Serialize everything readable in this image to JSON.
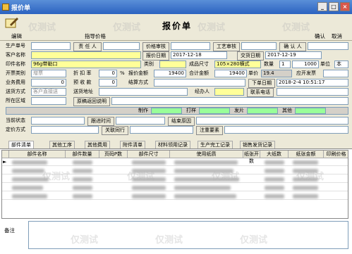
{
  "window": {
    "title": "报价单",
    "btn_min": "_",
    "btn_max": "□",
    "btn_close": "×"
  },
  "toolbar": {
    "doc_title": "报价单",
    "menu_edit": "编辑",
    "menu_price": "指导价格",
    "btn_confirm": "确认",
    "btn_cancel": "取消"
  },
  "form": {
    "prod_no_label": "生产单号",
    "resp_label": "责 任 人",
    "price_audit_label": "价格审核",
    "craft_audit_label": "工艺审核",
    "confirm_person_label": "确 认 人",
    "customer_label": "客户名称",
    "quote_date_label": "报价日期",
    "quote_date": "2017-12-18",
    "delivery_date_label": "交货日期",
    "delivery_date": "2017-12-19",
    "print_name_label": "印件名称",
    "print_name": "96g带勒口",
    "category_label": "类别",
    "product_size_label": "成品尺寸",
    "product_size": "105×280横式",
    "qty_label": "数量",
    "qty": "1",
    "unit_price_small": "1000",
    "unit_label": "单位",
    "unit": "本",
    "invoice_type_label": "开票类别",
    "invoice_type": "增票",
    "discount_label": "折 扣 率",
    "discount": "0",
    "pct": "%",
    "quote_amount_label": "报价金额",
    "quote_amount": "19400",
    "total_amount_label": "合计金额",
    "total_amount": "19400",
    "unit_price_label": "单价",
    "unit_price": "19.4",
    "receivable_label": "应开发票",
    "biz_fee_label": "业务费用",
    "biz_fee": "0",
    "pre_receive_label": "预 收 款",
    "pre_receive": "0",
    "settle_label": "结算方式",
    "order_date_label": "下单日期",
    "order_date": "2018-2-4 10:51:17",
    "ship_label": "送货方式",
    "ship": "客户直接送",
    "ship_addr_label": "送货地址",
    "handler_label": "经办人",
    "contact_label": "联系电话",
    "region_label": "所在区域",
    "manuscript_label": "原稿返回说明",
    "typeset_label": "制作",
    "drawing_label": "制作",
    "print_label": "打样",
    "film_label": "发片",
    "other_label": "其他",
    "status_label": "当前状态",
    "followup_label": "跟进时间",
    "close_reason_label": "结束原因",
    "pricing_label": "定价方式",
    "related_label": "关联同行",
    "note_label": "注重要素"
  },
  "tabs": [
    "部件清单",
    "其他工序",
    "其他费用",
    "附件清单",
    "材料领用记录",
    "生产完工记录",
    "销售发货记录"
  ],
  "grid": {
    "headers": [
      "部件名称",
      "部件数量",
      "页码P数",
      "部件尺寸",
      "使用纸质",
      "纸张开数",
      "大纸数",
      "纸张金额",
      "印刷价格"
    ],
    "rows": [
      {
        "marker": "►"
      },
      {
        "marker": ""
      },
      {
        "marker": ""
      },
      {
        "marker": ""
      },
      {
        "marker": ""
      }
    ]
  },
  "memo": {
    "label": "备注"
  },
  "watermark": {
    "text": "仅测试"
  },
  "colors": {
    "title_bar": "#2b62c0",
    "highlight_yellow": "#ffff99",
    "highlight_green": "#99ff99",
    "panel": "#ece9d8"
  }
}
